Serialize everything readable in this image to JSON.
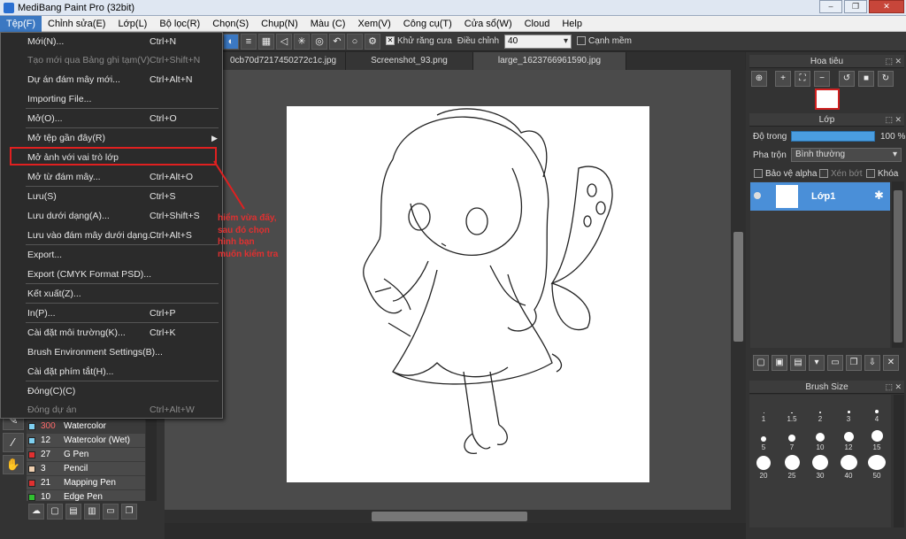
{
  "window": {
    "title": "MediBang Paint Pro (32bit)",
    "controls": [
      "–",
      "❐",
      "✕"
    ]
  },
  "menubar": [
    "Tệp(F)",
    "Chỉnh sửa(E)",
    "Lớp(L)",
    "Bộ lọc(R)",
    "Chọn(S)",
    "Chụp(N)",
    "Màu (C)",
    "Xem(V)",
    "Công cụ(T)",
    "Cửa sổ(W)",
    "Cloud",
    "Help"
  ],
  "toolbar": {
    "antialias_label": "Khử răng cưa",
    "adjust_label": "Điều chỉnh",
    "adjust_value": "40",
    "edge_label": "Cạnh mềm"
  },
  "tabs": [
    "0cb70d7217450272c1c.jpg",
    "Screenshot_93.png",
    "large_1623766961590.jpg"
  ],
  "file_menu": [
    {
      "label": "Mới(N)...",
      "shortcut": "Ctrl+N"
    },
    {
      "label": "Tạo mới qua Bảng ghi tạm(V)",
      "shortcut": "Ctrl+Shift+N",
      "disabled": true
    },
    {
      "label": "Dự án đám mây mới...",
      "shortcut": "Ctrl+Alt+N"
    },
    {
      "label": "Importing File...",
      "shortcut": ""
    },
    {
      "label": "Mở(O)...",
      "shortcut": "Ctrl+O"
    },
    {
      "label": "Mở tệp gần đây(R)",
      "shortcut": "",
      "submenu": true
    },
    {
      "label": "Mở ảnh với vai trò lớp",
      "shortcut": ""
    },
    {
      "label": "Mở từ đám mây...",
      "shortcut": "Ctrl+Alt+O"
    },
    {
      "label": "Lưu(S)",
      "shortcut": "Ctrl+S"
    },
    {
      "label": "Lưu dưới dạng(A)...",
      "shortcut": "Ctrl+Shift+S"
    },
    {
      "label": "Lưu vào đám mây dưới dạng...",
      "shortcut": "Ctrl+Alt+S"
    },
    {
      "label": "Export...",
      "shortcut": ""
    },
    {
      "label": "Export (CMYK Format PSD)...",
      "shortcut": ""
    },
    {
      "label": "Kết xuất(Z)...",
      "shortcut": ""
    },
    {
      "label": "In(P)...",
      "shortcut": "Ctrl+P"
    },
    {
      "label": "Cài đặt môi trường(K)...",
      "shortcut": "Ctrl+K"
    },
    {
      "label": "Brush Environment Settings(B)...",
      "shortcut": ""
    },
    {
      "label": "Cài đặt phím tắt(H)...",
      "shortcut": ""
    },
    {
      "label": "Đóng(C)(C)",
      "shortcut": ""
    },
    {
      "label": "Đóng dự án",
      "shortcut": "Ctrl+Alt+W",
      "disabled": true
    }
  ],
  "annotation": {
    "lines": [
      "hiểm vừa đấy,",
      "sau đó chọn",
      "hình bạn",
      "muốn kiểm tra"
    ],
    "color": "#e03030"
  },
  "brushes": [
    {
      "size": "300",
      "name": "Watercolor",
      "color": "#7fd0f0",
      "size_red": true
    },
    {
      "size": "12",
      "name": "Watercolor (Wet)",
      "color": "#7fd0f0"
    },
    {
      "size": "27",
      "name": "G Pen",
      "color": "#e03030"
    },
    {
      "size": "3",
      "name": "Pencil",
      "color": "#f0d0b0"
    },
    {
      "size": "21",
      "name": "Mapping Pen",
      "color": "#e03030"
    },
    {
      "size": "10",
      "name": "Edge Pen",
      "color": "#30c030"
    }
  ],
  "navigator": {
    "title": "Hoa tiêu"
  },
  "layers": {
    "title": "Lớp",
    "opacity_label": "Độ trong",
    "opacity_value": "100 %",
    "opacity": 1.0,
    "blend_label": "Pha trộn",
    "blend_value": "Bình thường",
    "alpha_label": "Bảo vệ alpha",
    "clip_label": "Xén bớt",
    "lock_label": "Khóa",
    "layer_name": "Lớp1"
  },
  "brush_size": {
    "title": "Brush Size",
    "sizes": [
      "1",
      "1.5",
      "2",
      "3",
      "4",
      "5",
      "7",
      "10",
      "12",
      "15",
      "20",
      "25",
      "30",
      "40",
      "50"
    ]
  },
  "accent": "#3b78c2"
}
